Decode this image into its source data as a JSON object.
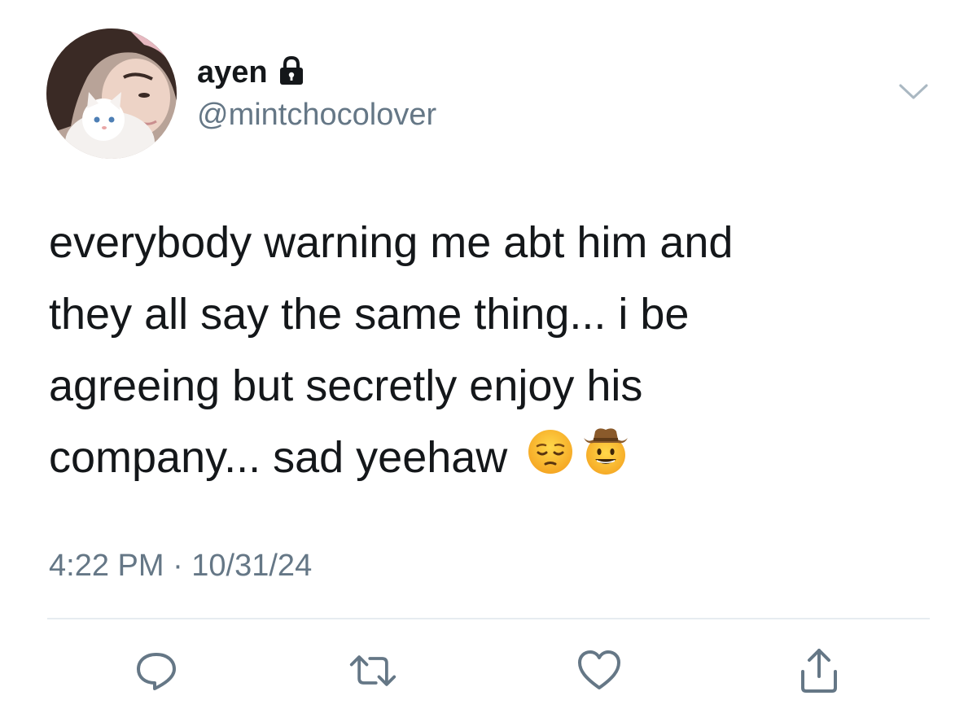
{
  "author": {
    "display_name": "ayen",
    "handle": "@mintchocolover",
    "avatar_icon": "avatar-photo",
    "lock_icon": "lock-icon"
  },
  "tweet": {
    "lines": [
      "everybody warning me abt him and",
      "they all say the same thing... i be",
      "agreeing but secretly enjoy his",
      "company... sad yeehaw"
    ],
    "emojis": [
      "pensive-face-emoji",
      "cowboy-hat-face-emoji"
    ],
    "timestamp": "4:22 PM · 10/31/24"
  },
  "actions": [
    {
      "name": "reply",
      "icon": "reply-icon"
    },
    {
      "name": "retweet",
      "icon": "retweet-icon"
    },
    {
      "name": "like",
      "icon": "heart-icon"
    },
    {
      "name": "share",
      "icon": "share-icon"
    }
  ],
  "colors": {
    "text": "#14171a",
    "secondary": "#657786",
    "divider": "#e6ecf0"
  }
}
